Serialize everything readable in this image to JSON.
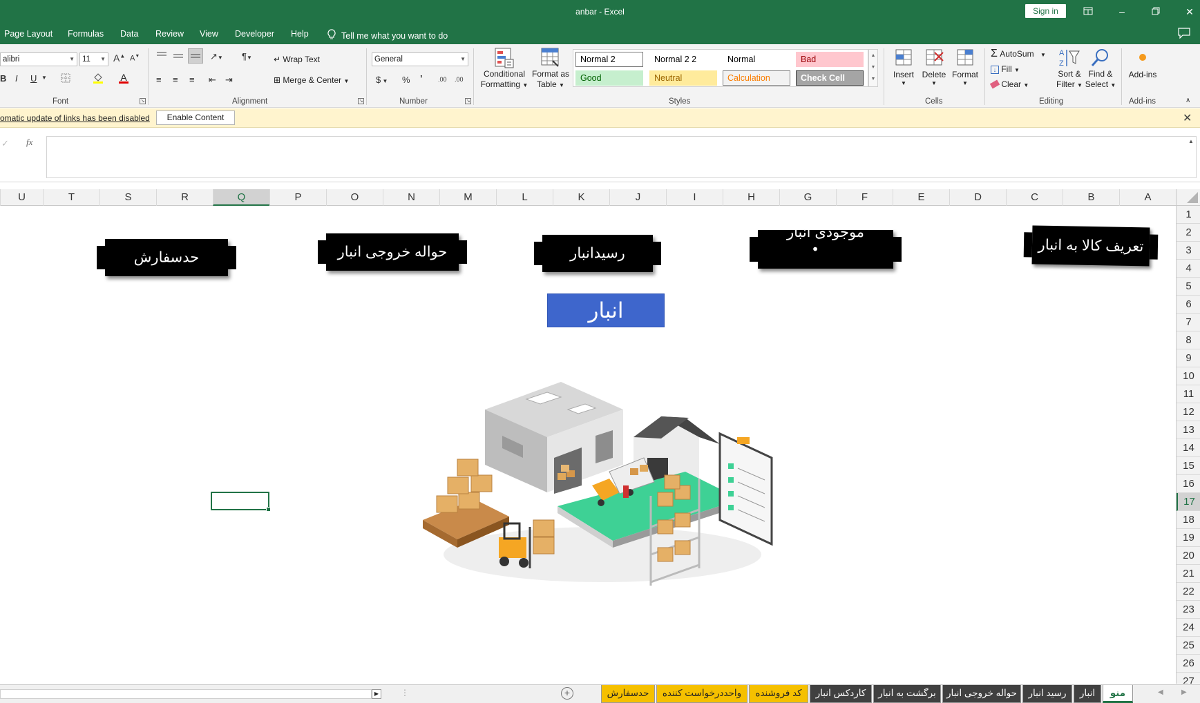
{
  "window": {
    "title": "anbar  -  Excel",
    "sign_in": "Sign in"
  },
  "tabs": [
    "Page Layout",
    "Formulas",
    "Data",
    "Review",
    "View",
    "Developer",
    "Help"
  ],
  "tell_me": "Tell me what you want to do",
  "ribbon": {
    "font": {
      "name": "alibri",
      "size": "11",
      "label": "Font",
      "grow": "A",
      "shrink": "A",
      "bold": "B",
      "italic": "I",
      "underline": "U",
      "font_color_letter": "A"
    },
    "alignment": {
      "label": "Alignment",
      "wrap_text": "Wrap Text",
      "merge_center": "Merge & Center"
    },
    "number": {
      "format": "General",
      "label": "Number",
      "currency": "$",
      "percent": "%",
      "comma": "’",
      "inc_decimal": ".00",
      "dec_decimal": ".00"
    },
    "styles": {
      "label": "Styles",
      "conditional_formatting": [
        "Conditional",
        "Formatting"
      ],
      "format_as_table": [
        "Format as",
        "Table"
      ],
      "cells": [
        {
          "label": "Normal 2",
          "bg": "#ffffff",
          "fg": "#000000",
          "border": "#7a7a7a"
        },
        {
          "label": "Normal 2 2",
          "bg": "transparent",
          "fg": "#000000",
          "border": "transparent"
        },
        {
          "label": "Normal",
          "bg": "transparent",
          "fg": "#000000",
          "border": "transparent"
        },
        {
          "label": "Bad",
          "bg": "#ffc7ce",
          "fg": "#9c0006",
          "border": "transparent"
        },
        {
          "label": "Good",
          "bg": "#c6efce",
          "fg": "#006100",
          "border": "transparent"
        },
        {
          "label": "Neutral",
          "bg": "#ffeb9c",
          "fg": "#9c6500",
          "border": "transparent"
        },
        {
          "label": "Calculation",
          "bg": "#f2f2f2",
          "fg": "#fa7d00",
          "border": "#7f7f7f"
        },
        {
          "label": "Check Cell",
          "bg": "#a5a5a5",
          "fg": "#ffffff",
          "border": "#3f3f3f"
        }
      ]
    },
    "cells": {
      "label": "Cells",
      "insert": "Insert",
      "delete": "Delete",
      "format": "Format"
    },
    "editing": {
      "label": "Editing",
      "autosum": "AutoSum",
      "fill": "Fill",
      "clear": "Clear",
      "sort_filter": [
        "Sort &",
        "Filter"
      ],
      "find_select": [
        "Find &",
        "Select"
      ]
    },
    "addins": {
      "label": "Add-ins",
      "button": "Add-ins"
    }
  },
  "message_bar": {
    "text": "omatic update of links has been disabled",
    "button": "Enable Content"
  },
  "formula_bar": {
    "fx": "fx",
    "value": ""
  },
  "columns": [
    "A",
    "B",
    "C",
    "D",
    "E",
    "F",
    "G",
    "H",
    "I",
    "J",
    "K",
    "L",
    "M",
    "N",
    "O",
    "P",
    "Q",
    "R",
    "S",
    "T",
    "U"
  ],
  "selected_column": "Q",
  "rows": [
    "1",
    "2",
    "3",
    "4",
    "5",
    "6",
    "7",
    "8",
    "9",
    "10",
    "11",
    "12",
    "13",
    "14",
    "15",
    "16",
    "17",
    "18",
    "19",
    "20",
    "21",
    "22",
    "23",
    "24",
    "25",
    "26",
    "27"
  ],
  "selected_row": "17",
  "sheet": {
    "buttons": {
      "define_goods": "تعریف کالا به انبار",
      "inventory": "موجودی انبار",
      "receipt": "رسیدانبار",
      "exit_remittance": "حواله خروجی انبار",
      "order_point": "حدسفارش"
    },
    "inventory_bullet": "•",
    "main_button": "انبار"
  },
  "sheet_tabs": [
    {
      "label": "منو",
      "style": "active"
    },
    {
      "label": "انبار",
      "style": "dark"
    },
    {
      "label": "رسید انبار",
      "style": "dark"
    },
    {
      "label": "حواله خروجی انبار",
      "style": "dark"
    },
    {
      "label": "برگشت به انبار",
      "style": "dark"
    },
    {
      "label": "کاردکس انبار",
      "style": "dark"
    },
    {
      "label": "کد فروشنده",
      "style": "yellow"
    },
    {
      "label": "واحددرخواست کننده",
      "style": "yellow"
    },
    {
      "label": "حدسفارش",
      "style": "yellow"
    }
  ],
  "colors": {
    "excel_green": "#217346",
    "message_bar": "#fff4ce",
    "anbar_button": "#3e66cc"
  }
}
